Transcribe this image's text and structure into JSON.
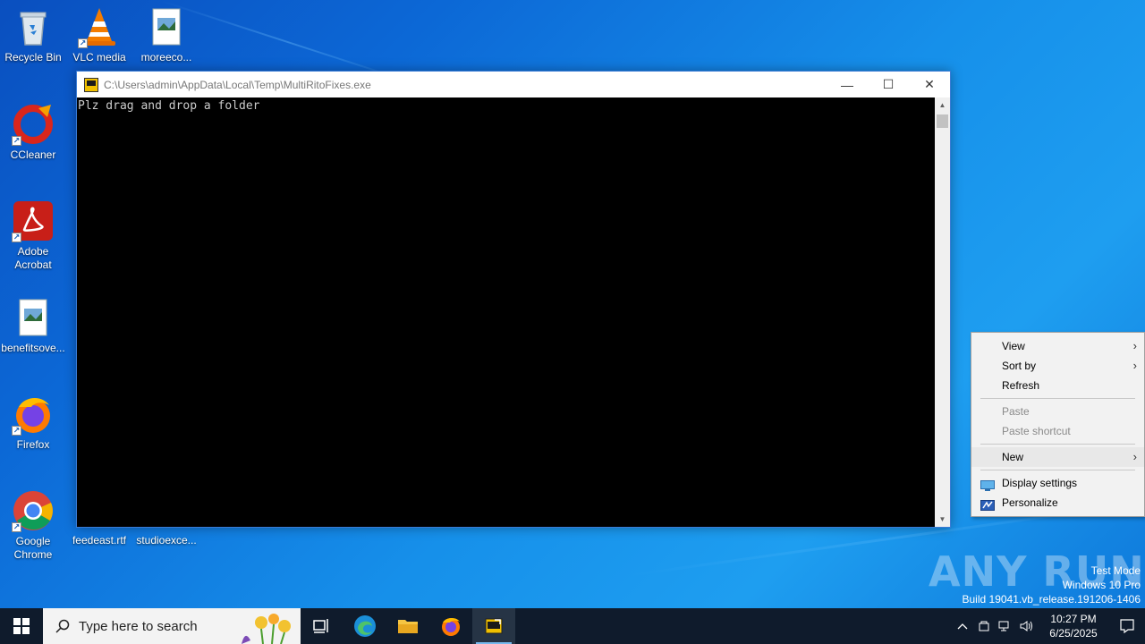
{
  "desktop": {
    "icons": [
      {
        "label": "Recycle Bin"
      },
      {
        "label": "VLC media"
      },
      {
        "label": "moreeco..."
      },
      {
        "label": "CCleaner"
      },
      {
        "label": "Adobe Acrobat"
      },
      {
        "label": "benefitsove..."
      },
      {
        "label": "Firefox"
      },
      {
        "label": "Google Chrome"
      },
      {
        "label": "feedeast.rtf"
      },
      {
        "label": "studioexce..."
      }
    ]
  },
  "console": {
    "title": "C:\\Users\\admin\\AppData\\Local\\Temp\\MultiRitoFixes.exe",
    "output": "Plz drag and drop a folder",
    "controls": {
      "minimize": "—",
      "maximize": "☐",
      "close": "✕"
    }
  },
  "context_menu": {
    "items": [
      {
        "label": "View",
        "submenu": true
      },
      {
        "label": "Sort by",
        "submenu": true
      },
      {
        "label": "Refresh"
      },
      {
        "label": "Paste",
        "disabled": true
      },
      {
        "label": "Paste shortcut",
        "disabled": true
      },
      {
        "label": "New",
        "submenu": true
      },
      {
        "label": "Display settings"
      },
      {
        "label": "Personalize"
      }
    ]
  },
  "watermark": {
    "brand": "ANY RUN",
    "line1": "Test Mode",
    "line2": "Windows 10 Pro",
    "line3": "Build 19041.vb_release.191206-1406"
  },
  "taskbar": {
    "search_placeholder": "Type here to search",
    "time": "10:27 PM",
    "date": "6/25/2025"
  }
}
